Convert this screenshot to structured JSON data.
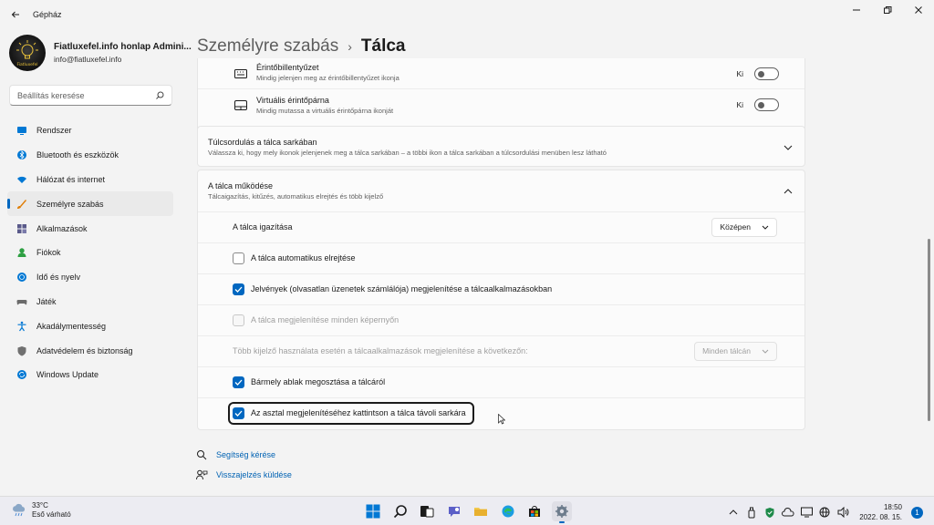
{
  "window": {
    "title": "Gépház"
  },
  "profile": {
    "name": "Fiatluxefel.info honlap Admini...",
    "email": "info@fiatluxefel.info",
    "logo_text": "Fiatluxefel"
  },
  "search": {
    "placeholder": "Beállítás keresése"
  },
  "nav": {
    "items": [
      {
        "label": "Rendszer",
        "icon": "system-icon"
      },
      {
        "label": "Bluetooth és eszközök",
        "icon": "bluetooth-icon"
      },
      {
        "label": "Hálózat és internet",
        "icon": "wifi-icon"
      },
      {
        "label": "Személyre szabás",
        "icon": "brush-icon",
        "active": true
      },
      {
        "label": "Alkalmazások",
        "icon": "apps-icon"
      },
      {
        "label": "Fiókok",
        "icon": "person-icon"
      },
      {
        "label": "Idő és nyelv",
        "icon": "globe-icon"
      },
      {
        "label": "Játék",
        "icon": "gamepad-icon"
      },
      {
        "label": "Akadálymentesség",
        "icon": "accessibility-icon"
      },
      {
        "label": "Adatvédelem és biztonság",
        "icon": "shield-icon"
      },
      {
        "label": "Windows Update",
        "icon": "update-icon"
      }
    ]
  },
  "breadcrumb": {
    "parent": "Személyre szabás",
    "separator": "›",
    "current": "Tálca"
  },
  "pen_card": {
    "touch_keyboard": {
      "title": "Érintőbillentyűzet",
      "subtitle": "Mindig jelenjen meg az érintőbillentyűzet ikonja",
      "state": "Ki"
    },
    "touchpad": {
      "title": "Virtuális érintőpárna",
      "subtitle": "Mindig mutassa a virtuális érintőpárna ikonját",
      "state": "Ki"
    }
  },
  "overflow": {
    "title": "Túlcsordulás a tálca sarkában",
    "subtitle": "Válassza ki, hogy mely ikonok jelenjenek meg a tálca sarkában – a többi ikon a tálca sarkában a túlcsordulási menüben lesz látható"
  },
  "behaviors": {
    "title": "A tálca működése",
    "subtitle": "Tálcaigazítás, kitűzés, automatikus elrejtés és több kijelző",
    "alignment_label": "A tálca igazítása",
    "alignment_value": "Középen",
    "autohide_label": "A tálca automatikus elrejtése",
    "autohide_checked": false,
    "badges_label": "Jelvények (olvasatlan üzenetek számlálója) megjelenítése a tálcaalkalmazásokban",
    "badges_checked": true,
    "all_displays_label": "A tálca megjelenítése minden képernyőn",
    "all_displays_checked": false,
    "multi_display_label": "Több kijelző használata esetén a tálcaalkalmazások megjelenítése a következőn:",
    "multi_display_value": "Minden tálcán",
    "share_label": "Bármely ablak megosztása a tálcáról",
    "share_checked": true,
    "far_corner_label": "Az asztal megjelenítéséhez kattintson a tálca távoli sarkára",
    "far_corner_checked": true
  },
  "links": {
    "help": "Segítség kérése",
    "feedback": "Visszajelzés küldése"
  },
  "taskbar": {
    "temperature": "33°C",
    "weather_desc": "Eső várható",
    "time": "18:50",
    "date": "2022. 08. 15.",
    "notification_count": "1"
  },
  "colors": {
    "accent": "#0067c0",
    "background": "#f3f3f3",
    "card": "#fbfbfb"
  }
}
